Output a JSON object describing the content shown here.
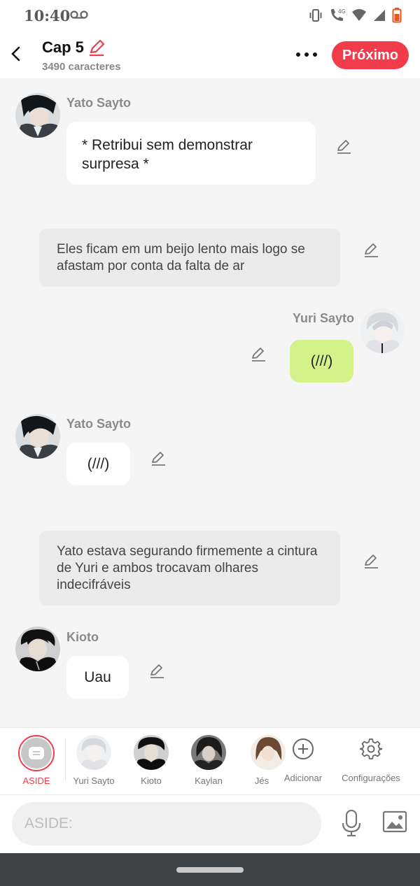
{
  "status_bar": {
    "time": "10:40"
  },
  "header": {
    "title": "Cap 5",
    "char_count": "3490 caracteres",
    "next_label": "Próximo"
  },
  "messages": {
    "m1": {
      "sender": "Yato Sayto",
      "text": "* Retribui sem demonstrar surpresa *"
    },
    "n1": {
      "text": "Eles ficam em um beijo lento mais logo se afastam por conta da falta de ar"
    },
    "m2": {
      "sender": "Yuri Sayto",
      "text": "(///)"
    },
    "m3": {
      "sender": "Yato Sayto",
      "text": "(///)"
    },
    "n2": {
      "text": "Yato estava segurando firmemente a cintura de Yuri e ambos trocavam olhares indecifráveis"
    },
    "m4": {
      "sender": "Kioto",
      "text": "Uau"
    }
  },
  "characters": {
    "aside": "ASIDE",
    "c1": "Yuri Sayto",
    "c2": "Kioto",
    "c3": "Kaylan",
    "c4": "Jés",
    "add": "Adicionar",
    "settings": "Configurações"
  },
  "composer": {
    "placeholder": "ASIDE:"
  },
  "colors": {
    "accent": "#f23c4b",
    "green_bubble": "#d4f28a",
    "narration_bg": "#ebebeb"
  }
}
